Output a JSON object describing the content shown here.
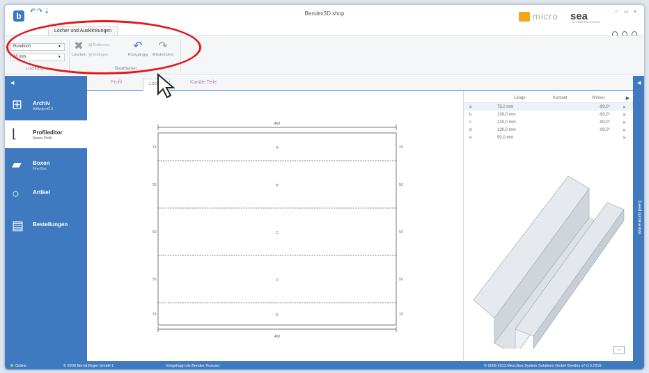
{
  "window": {
    "title": "Bendex3D.shop",
    "min": "–",
    "max": "▭",
    "close": "✕"
  },
  "ribbon": {
    "tab_label": "Löcher und Ausklinkungen",
    "lochung_type": "Rundloch",
    "lochung_size": "10 mm",
    "loeschen": "Löschen",
    "entfernen": "Entfernen",
    "einfuegen": "Einfügen",
    "rueckgaengig": "Rückgängig",
    "wiederholen": "Wiederholen",
    "group_lochung": "Lochung",
    "group_bearbeiten": "Bearbeiten"
  },
  "brand": {
    "micro": "micro",
    "sea": "sea",
    "sub": "SYSTEM SOLUTIONS"
  },
  "sidebar": {
    "items": [
      {
        "title": "Archiv",
        "subtitle": "Artikelprofil 3"
      },
      {
        "title": "Profileditor",
        "subtitle": "Neues Profil"
      },
      {
        "title": "Boxen",
        "subtitle": "Fine Box"
      },
      {
        "title": "Artikel",
        "subtitle": ""
      },
      {
        "title": "Bestellungen",
        "subtitle": ""
      }
    ]
  },
  "doc_tabs": {
    "tab_a": "Profil",
    "tab_b": "Löcher",
    "tab_c": "Kanäle Teile"
  },
  "drawing": {
    "top_dim": "400",
    "bottom_dim": "400",
    "sections": [
      {
        "label": "A",
        "side_dim": "19"
      },
      {
        "label": "B",
        "side_dim": "50"
      },
      {
        "label": "C",
        "side_dim": "50"
      },
      {
        "label": "D",
        "side_dim": "50"
      },
      {
        "label": "E",
        "side_dim": "19"
      }
    ]
  },
  "segments": {
    "headers": [
      "",
      "Länge",
      "Kontakt",
      "Winkel"
    ],
    "rows": [
      {
        "id": "a",
        "laenge": "75,0 mm",
        "winkel": "-90,0°"
      },
      {
        "id": "b",
        "laenge": "130,0 mm",
        "winkel": "-90,0°"
      },
      {
        "id": "c",
        "laenge": "130,0 mm",
        "winkel": "-90,0°"
      },
      {
        "id": "d",
        "laenge": "130,0 mm",
        "winkel": "-90,0°"
      },
      {
        "id": "e",
        "laenge": "50,0 mm",
        "winkel": ""
      }
    ]
  },
  "right_panel": {
    "vertical_label": "Warenkorb (leer)"
  },
  "status": {
    "online": "Online",
    "copyright": "© 2000 Bernd Beger GmbH 1",
    "login": "Eingeloggt als Bendex Testuser",
    "right": "© 2006-2013 MicroSea System Solutions GmbH    Bendex v7.0.0.7216"
  },
  "colors": {
    "accent": "#3f79c0",
    "annotation": "#e0191c",
    "brand_orange": "#f2a71b"
  }
}
